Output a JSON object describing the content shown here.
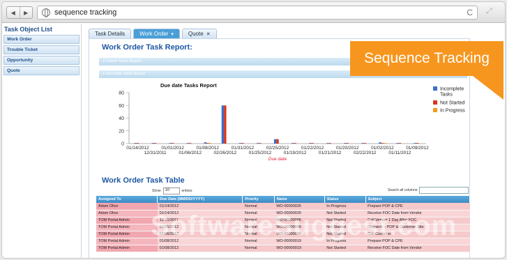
{
  "browser": {
    "url": "sequence tracking",
    "back_glyph": "◀",
    "forward_glyph": "▶",
    "reload_glyph": "C",
    "expand_glyph": "⤢"
  },
  "sidebar": {
    "title": "Task Object List",
    "items": [
      {
        "label": "Work Order"
      },
      {
        "label": "Trouble Ticket"
      },
      {
        "label": "Opportunity"
      },
      {
        "label": "Quote"
      }
    ]
  },
  "tabs": [
    {
      "label": "Task Details",
      "active": false,
      "closable": false
    },
    {
      "label": "Work Order",
      "active": true,
      "closable": true
    },
    {
      "label": "Quote",
      "active": false,
      "closable": true
    }
  ],
  "report": {
    "heading": "Work Order Task Report:",
    "section1": "▸ Owner Tasks Report",
    "section2": "▸ Due date Tasks Report"
  },
  "banner": {
    "text": "Sequence Tracking",
    "color": "#f7961e"
  },
  "chart_data": {
    "type": "bar",
    "title": "Due date Tasks Report",
    "xlabel": "Due date",
    "ylabel": "",
    "ylim": [
      0,
      80
    ],
    "yticks": [
      0,
      20,
      40,
      60,
      80
    ],
    "categories": [
      "01/14/2012",
      "12/31/2011",
      "01/01/2012",
      "01/06/2012",
      "01/08/2012",
      "02/26/2012",
      "01/31/2012",
      "01/25/2012",
      "02/25/2012",
      "01/19/2012",
      "01/22/2012",
      "01/21/2012",
      "01/20/2012",
      "02/22/2012",
      "01/02/2012",
      "01/11/2012",
      "01/09/2012"
    ],
    "series": [
      {
        "name": "Incomplete Tasks",
        "color": "#3a6fc9",
        "values": [
          1,
          1,
          1,
          1,
          2,
          60,
          1,
          1,
          7,
          1,
          1,
          1,
          1,
          1,
          2,
          1,
          1
        ]
      },
      {
        "name": "Not Started",
        "color": "#d9361e",
        "values": [
          1,
          1,
          1,
          1,
          1,
          60,
          1,
          1,
          7,
          1,
          1,
          1,
          1,
          1,
          1,
          1,
          1
        ]
      },
      {
        "name": "In Progress",
        "color": "#f39a1f",
        "values": [
          0,
          0,
          0,
          0,
          1,
          0,
          0,
          0,
          0,
          0,
          0,
          0,
          0,
          0,
          1,
          0,
          0
        ]
      }
    ],
    "legend_position": "right",
    "grid": false
  },
  "table": {
    "heading": "Work Order Task Table",
    "show_label": "Show",
    "show_value": "10",
    "entries_label": "entries",
    "search_label": "Search all columns:",
    "columns": [
      "Assigned To",
      "Due Date (MM/DD/YYYY)",
      "Priority",
      "Name",
      "Status",
      "Subject"
    ],
    "rows": [
      [
        "Adam Olivo",
        "01/14/2012",
        "Normal",
        "WO-00000026",
        "In Progress",
        "Prepare POP & CPE"
      ],
      [
        "Adam Olivo",
        "01/14/2012",
        "Normal",
        "WO-00000026",
        "Not Started",
        "Receive FOC Date from Vendor"
      ],
      [
        "TOM Portal Admin",
        "12/31/2011",
        "Normal",
        "WO-00000006",
        "Not Started",
        "Call Vendor 1 Day After FOC"
      ],
      [
        "TOM Portal Admin",
        "01/01/2012",
        "Normal",
        "WO-00000006",
        "Not Started",
        "Dispatch – POP & Customer Site"
      ],
      [
        "TOM Portal Admin",
        "01/06/2012",
        "Normal",
        "WO-00000006",
        "Not Started",
        "Call Customer"
      ],
      [
        "TOM Portal Admin",
        "01/08/2012",
        "Normal",
        "WO-00000019",
        "In Progress",
        "Prepare POP & CPE"
      ],
      [
        "TOM Portal Admin",
        "01/08/2012",
        "Normal",
        "WO-00000019",
        "Not Started",
        "Receive FOC Date from Vendor"
      ]
    ]
  },
  "watermark": "SoftwareSuggest.com"
}
